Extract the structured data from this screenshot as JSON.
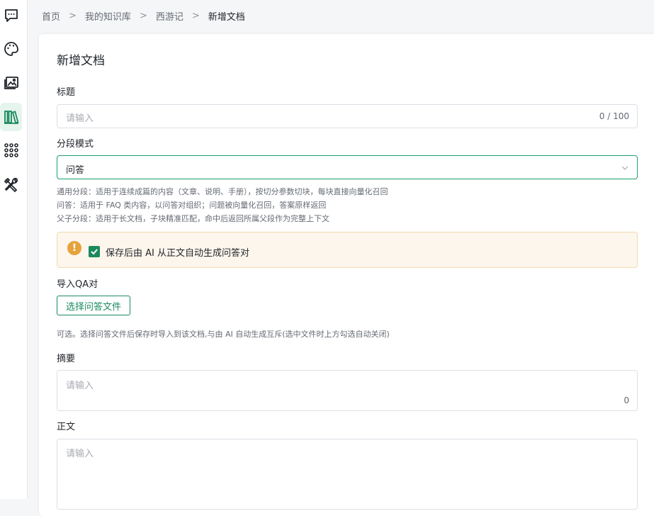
{
  "sidebar": {
    "items": [
      {
        "icon": "chat-icon"
      },
      {
        "icon": "palette-icon"
      },
      {
        "icon": "image-icon"
      },
      {
        "icon": "library-icon",
        "active": true
      },
      {
        "icon": "apps-grid-icon"
      },
      {
        "icon": "tools-icon"
      }
    ],
    "accent": "#1a8a5e"
  },
  "breadcrumb": {
    "home": "首页",
    "separator": ">",
    "kb": "我的知识库",
    "book": "西游记",
    "current": "新增文档"
  },
  "form": {
    "title": "新增文档",
    "title_label": "标题",
    "title_placeholder": "请输入",
    "title_counter": "0 / 100",
    "mode_label": "分段模式",
    "mode_value": "问答",
    "hints": [
      "通用分段：适用于连续成篇的内容（文章、说明、手册），按切分参数切块，每块直接向量化召回",
      "问答：适用于 FAQ 类内容，以问答对组织；问题被向量化召回，答案原样返回",
      "父子分段：适用于长文档，子块精准匹配，命中后返回所属父段作为完整上下文"
    ],
    "alert_text": "保存后由 AI 从正文自动生成问答对",
    "alert_checked": true,
    "import_label": "导入QA对",
    "import_button": "选择问答文件",
    "import_hint": "可选。选择问答文件后保存时导入到该文档,与由 AI 自动生成互斥(选中文件时上方勾选自动关闭)",
    "summary_label": "摘要",
    "summary_placeholder": "请输入",
    "summary_counter": "0",
    "body_label": "正文",
    "body_placeholder": "请输入"
  }
}
